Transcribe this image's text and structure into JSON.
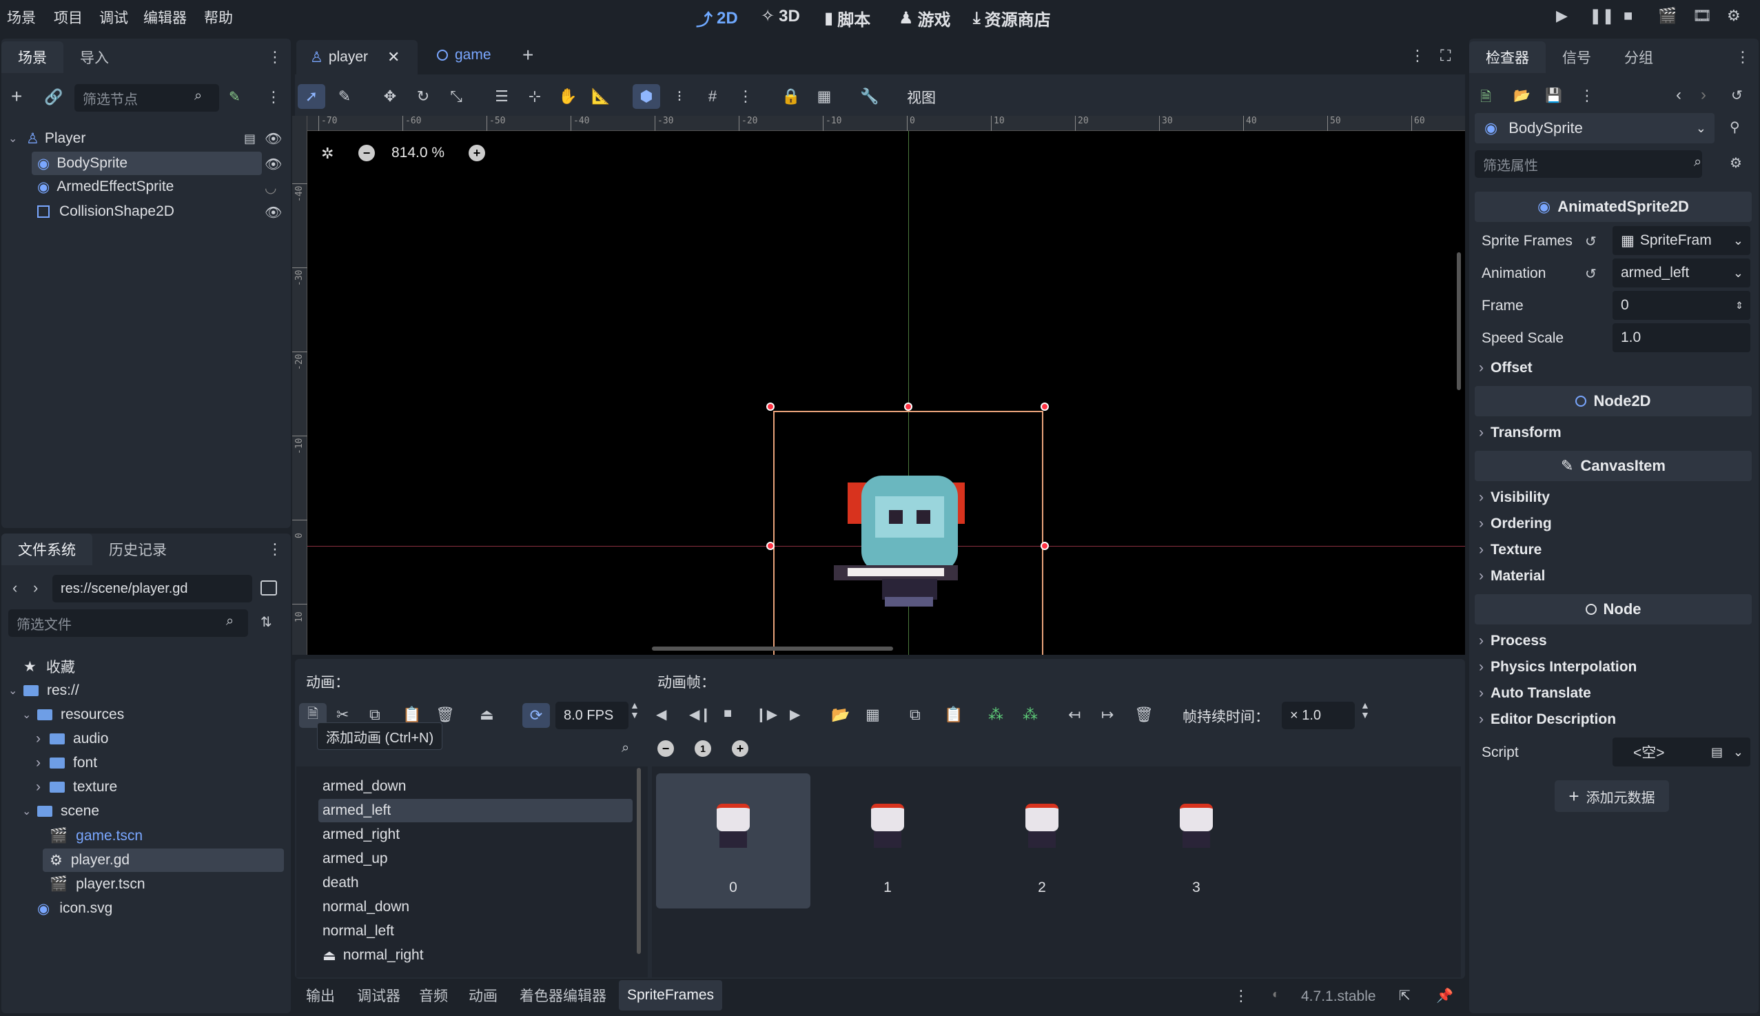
{
  "menu": {
    "items": [
      "场景",
      "项目",
      "调试",
      "编辑器",
      "帮助"
    ]
  },
  "modes": {
    "m2d": "2D",
    "m3d": "3D",
    "script": "脚本",
    "game": "游戏",
    "assetlib": "资源商店"
  },
  "scene_panel": {
    "tab_scene": "场景",
    "tab_import": "导入",
    "filter_placeholder": "筛选节点",
    "nodes": [
      {
        "name": "Player"
      },
      {
        "name": "BodySprite"
      },
      {
        "name": "ArmedEffectSprite"
      },
      {
        "name": "CollisionShape2D"
      }
    ]
  },
  "fs_panel": {
    "tab_fs": "文件系统",
    "tab_history": "历史记录",
    "path": "res://scene/player.gd",
    "filter_placeholder": "筛选文件",
    "favorites": "收藏",
    "root": "res://",
    "resources": "resources",
    "audio": "audio",
    "font": "font",
    "texture": "texture",
    "scene": "scene",
    "game_tscn": "game.tscn",
    "player_gd": "player.gd",
    "player_tscn": "player.tscn",
    "icon_svg": "icon.svg"
  },
  "editor_tabs": {
    "player": "player",
    "game": "game"
  },
  "toolbar": {
    "view": "视图"
  },
  "viewport": {
    "zoom": "814.0 %"
  },
  "ruler_h": [
    "-70",
    "-60",
    "-50",
    "-40",
    "-30",
    "-20",
    "-10",
    "0",
    "10",
    "20",
    "30",
    "40",
    "50",
    "60"
  ],
  "ruler_v": [
    "-40",
    "-30",
    "-20",
    "-10",
    "0",
    "10"
  ],
  "anim_panel": {
    "title": "动画：",
    "frames_title": "动画帧：",
    "fps": "8.0 FPS",
    "duration_label": "帧持续时间：",
    "duration_value": "× 1.0",
    "tooltip": "添加动画 (Ctrl+N)",
    "filter_placeholder": "筛选动画",
    "animations": [
      "armed_down",
      "armed_left",
      "armed_right",
      "armed_up",
      "death",
      "normal_down",
      "normal_left",
      "normal_right"
    ],
    "frames": [
      "0",
      "1",
      "2",
      "3"
    ]
  },
  "bottom_tabs": [
    "输出",
    "调试器",
    "音频",
    "动画",
    "着色器编辑器",
    "SpriteFrames"
  ],
  "version": "4.7.1.stable",
  "inspector": {
    "tab_inspector": "检查器",
    "tab_signal": "信号",
    "tab_group": "分组",
    "node_name": "BodySprite",
    "filter_placeholder": "筛选属性",
    "class_animsprite": "AnimatedSprite2D",
    "sprite_frames_label": "Sprite Frames",
    "sprite_frames_value": "SpriteFram",
    "animation_label": "Animation",
    "animation_value": "armed_left",
    "frame_label": "Frame",
    "frame_value": "0",
    "speed_label": "Speed Scale",
    "speed_value": "1.0",
    "offset": "Offset",
    "class_node2d": "Node2D",
    "transform": "Transform",
    "class_canvasitem": "CanvasItem",
    "visibility": "Visibility",
    "ordering": "Ordering",
    "texture": "Texture",
    "material": "Material",
    "class_node": "Node",
    "process": "Process",
    "physics_interp": "Physics Interpolation",
    "auto_translate": "Auto Translate",
    "editor_desc": "Editor Description",
    "script_label": "Script",
    "script_value": "<空>",
    "add_metadata": "添加元数据"
  },
  "colors": {
    "accent": "#6fa9ff",
    "panel": "#252b34",
    "selection": "#3b4350",
    "viewport": "#000000"
  }
}
